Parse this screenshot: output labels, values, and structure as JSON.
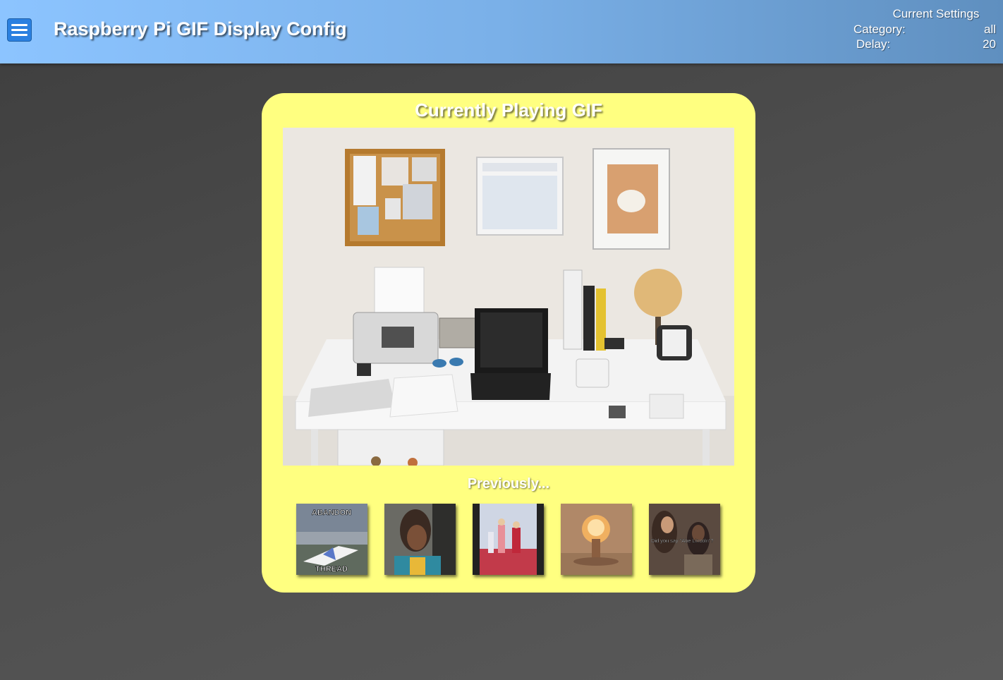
{
  "header": {
    "title": "Raspberry Pi GIF Display Config",
    "menu_icon": "hamburger-menu-icon",
    "settings": {
      "title": "Current Settings",
      "category_label": "Category:",
      "category_value": "all",
      "delay_label": "Delay:",
      "delay_value": "20"
    }
  },
  "player": {
    "title": "Currently Playing GIF",
    "previously_label": "Previously...",
    "thumbnails": [
      {
        "top_caption": "ABANDON",
        "bottom_caption": "THREAD"
      },
      {},
      {},
      {},
      {
        "caption": "Did you say \"Abe Lincoln\"?"
      }
    ]
  },
  "colors": {
    "header_start": "#8cc4ff",
    "header_end": "#5f8fbf",
    "menu_button": "#2b80e0",
    "card_background": "#ffff80",
    "page_background": "#4d4d4d"
  }
}
